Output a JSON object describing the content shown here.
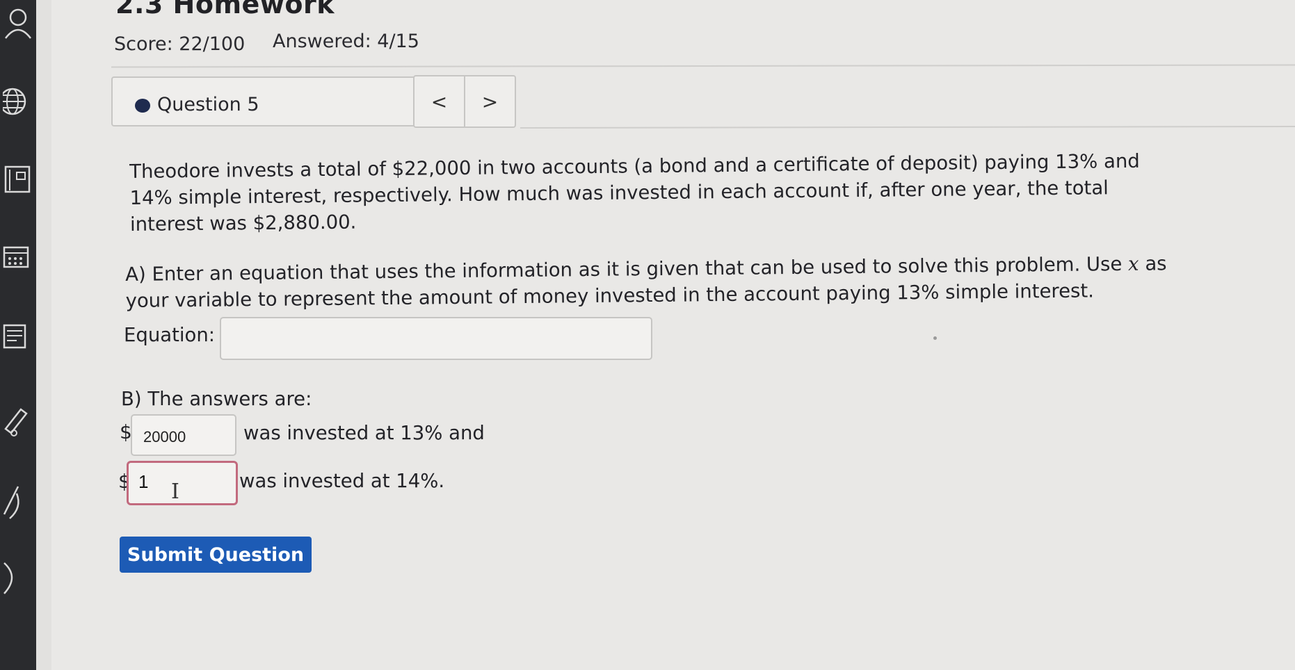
{
  "header": {
    "title": "2.3 Homework",
    "score": "Score: 22/100",
    "answered": "Answered: 4/15"
  },
  "question_nav": {
    "selected": "Question 5",
    "caret": "▼",
    "prev": "<",
    "next": ">"
  },
  "problem": {
    "text": "Theodore invests a total of $22,000 in two accounts (a bond and a certificate of deposit) paying 13% and 14% simple interest, respectively. How much was invested in each account if, after one year, the total interest was $2,880.00.",
    "part_a_before": "A) Enter an equation that uses the information as it is given that can be used to solve this problem. Use",
    "part_a_var": "x",
    "part_a_after": "as your variable to represent the amount of money invested in the account paying 13% simple interest.",
    "equation_label": "Equation:",
    "equation_value": ""
  },
  "part_b": {
    "heading": "B) The answers are:",
    "currency": "$",
    "amount_13_value": "20000",
    "amount_13_text": "was invested at 13% and",
    "amount_14_value": "1",
    "amount_14_text": "was invested at 14%."
  },
  "actions": {
    "submit_label": "Submit Question"
  },
  "icons": [
    "user-icon",
    "globe-icon",
    "gradebook-icon",
    "calendar-icon",
    "messages-icon",
    "edit-icon",
    "tools-icon"
  ],
  "colors": {
    "sidebar": "#2a2b2e",
    "submit_button": "#1d5bb5",
    "active_input_border": "#c26a7e",
    "question_dot": "#1f2b4f"
  }
}
